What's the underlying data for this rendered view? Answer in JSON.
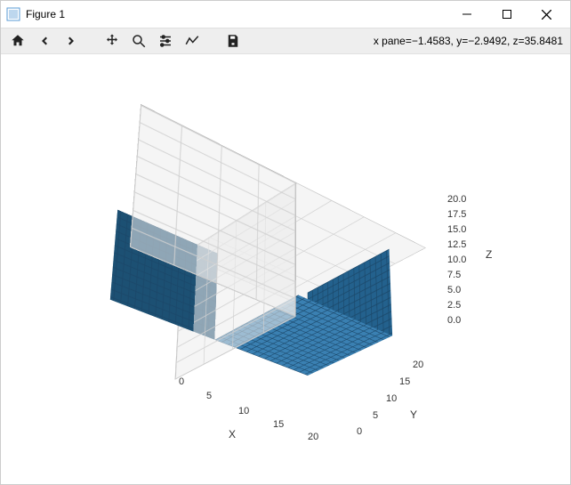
{
  "window": {
    "title": "Figure 1"
  },
  "toolbar": {
    "home": "Home",
    "back": "Back",
    "forward": "Forward",
    "pan": "Pan",
    "zoom": "Zoom",
    "subplots": "Configure subplots",
    "edit": "Edit",
    "save": "Save"
  },
  "status": {
    "text": "x pane=−1.4583, y=−2.9492, z=35.8481"
  },
  "chart_data": {
    "type": "3d-voxel",
    "xlabel": "X",
    "ylabel": "Y",
    "zlabel": "Z",
    "x_ticks": [
      0,
      5,
      10,
      15,
      20
    ],
    "y_ticks": [
      0,
      5,
      10,
      15,
      20
    ],
    "z_ticks": [
      0.0,
      2.5,
      5.0,
      7.5,
      10.0,
      12.5,
      15.0,
      17.5,
      20.0
    ],
    "x_range": [
      0,
      20
    ],
    "y_range": [
      0,
      20
    ],
    "z_range": [
      0,
      20
    ],
    "object": {
      "shape": "cube",
      "x": [
        3,
        17
      ],
      "y": [
        3,
        17
      ],
      "z": [
        0,
        14
      ],
      "color": "#2e73a5"
    }
  },
  "ticks": {
    "zt0": "0.0",
    "zt1": "2.5",
    "zt2": "5.0",
    "zt3": "7.5",
    "zt4": "10.0",
    "zt5": "12.5",
    "zt6": "15.0",
    "zt7": "17.5",
    "zt8": "20.0",
    "xt0": "0",
    "xt1": "5",
    "xt2": "10",
    "xt3": "15",
    "xt4": "20",
    "yt0": "0",
    "yt1": "5",
    "yt2": "10",
    "yt3": "15",
    "yt4": "20"
  }
}
